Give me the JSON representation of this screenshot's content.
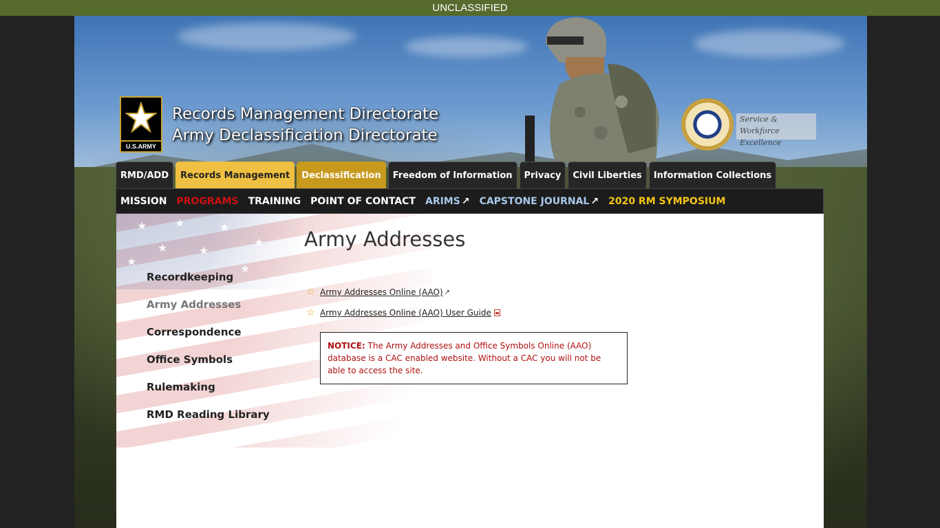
{
  "classification_banner": "UNCLASSIFIED",
  "header": {
    "logo_text": "U.S.ARMY",
    "title_line1": "Records Management Directorate",
    "title_line2": "Army Declassification Directorate",
    "service_text_line1": "Service & Workforce",
    "service_text_line2": "Excellence"
  },
  "tabs": [
    {
      "label": "RMD/ADD",
      "state": "normal"
    },
    {
      "label": "Records Management",
      "state": "active"
    },
    {
      "label": "Declassification",
      "state": "gold"
    },
    {
      "label": "Freedom of Information",
      "state": "normal"
    },
    {
      "label": "Privacy",
      "state": "normal"
    },
    {
      "label": "Civil Liberties",
      "state": "normal"
    },
    {
      "label": "Information Collections",
      "state": "normal"
    }
  ],
  "subnav": [
    {
      "label": "MISSION",
      "color": "#ffffff"
    },
    {
      "label": "PROGRAMS",
      "color": "#cc1111"
    },
    {
      "label": "TRAINING",
      "color": "#ffffff"
    },
    {
      "label": "POINT OF CONTACT",
      "color": "#ffffff"
    },
    {
      "label": "ARIMS",
      "color": "#a9c9ea",
      "external": true
    },
    {
      "label": "CAPSTONE JOURNAL",
      "color": "#a9c9ea",
      "external": true
    },
    {
      "label": "2020 RM SYMPOSIUM",
      "color": "#f5c518"
    }
  ],
  "sidebar": {
    "items": [
      {
        "label": "Recordkeeping"
      },
      {
        "label": "Army Addresses",
        "current": true
      },
      {
        "label": "Correspondence"
      },
      {
        "label": "Office Symbols"
      },
      {
        "label": "Rulemaking"
      },
      {
        "label": "RMD Reading Library"
      }
    ]
  },
  "main": {
    "title": "Army Addresses",
    "links": [
      {
        "label": "Army Addresses Online (AAO)",
        "icon": "external-link-icon"
      },
      {
        "label": "Army Addresses Online (AAO) User Guide",
        "icon": "pdf-icon"
      }
    ],
    "notice_label": "NOTICE:",
    "notice_text": " The Army Addresses and Office Symbols Online (AAO) database is a CAC enabled website. Without a CAC you will not be able to access the site."
  },
  "colors": {
    "banner": "#566b2d",
    "active_tab": "#f0c042",
    "gold_tab": "#c79a1e",
    "notice_text": "#b01010"
  }
}
